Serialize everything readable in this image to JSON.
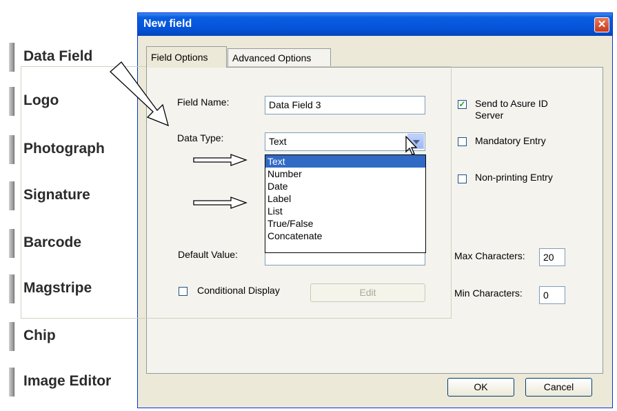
{
  "palette": {
    "items": [
      {
        "label": "Data Field"
      },
      {
        "label": "Logo"
      },
      {
        "label": "Photograph"
      },
      {
        "label": "Signature"
      },
      {
        "label": "Barcode"
      },
      {
        "label": "Magstripe"
      },
      {
        "label": "Chip"
      },
      {
        "label": "Image Editor"
      }
    ]
  },
  "dialog": {
    "title": "New field",
    "close_icon": "close-icon",
    "tabs": [
      {
        "label": "Field Options",
        "active": true
      },
      {
        "label": "Advanced Options",
        "active": false
      }
    ],
    "field_name": {
      "label": "Field Name:",
      "value": "Data Field 3"
    },
    "data_type": {
      "label": "Data Type:",
      "value": "Text",
      "options": [
        "Text",
        "Number",
        "Date",
        "Label",
        "List",
        "True/False",
        "Concatenate"
      ],
      "selected_option": "Text"
    },
    "default_value": {
      "label": "Default Value:",
      "value": ""
    },
    "conditional_display": {
      "label": "Conditional Display",
      "checked": false
    },
    "edit_button": "Edit",
    "send_to_server": {
      "label": "Send to Asure ID Server",
      "checked": true
    },
    "mandatory_entry": {
      "label": "Mandatory Entry",
      "checked": false
    },
    "non_printing_entry": {
      "label": "Non-printing Entry",
      "checked": false
    },
    "max_characters": {
      "label": "Max Characters:",
      "value": "20"
    },
    "min_characters": {
      "label": "Min Characters:",
      "value": "0"
    },
    "ok_button": "OK",
    "cancel_button": "Cancel"
  },
  "colors": {
    "titlebar": "#0553d9",
    "dialog_bg": "#ece9d8",
    "selection": "#316ac5",
    "checkmark": "#21a121"
  }
}
